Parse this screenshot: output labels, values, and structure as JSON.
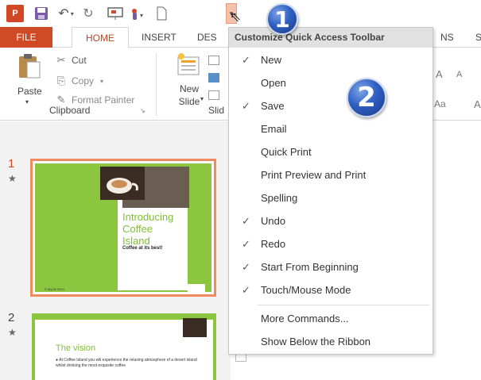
{
  "qat": {
    "logo_text": "P",
    "items": [
      "save-icon",
      "undo-icon",
      "redo-icon",
      "start-from-beginning-icon",
      "touch-mode-icon",
      "new-icon",
      "customize-dropdown-icon"
    ],
    "customize_glyph": "▾"
  },
  "tabs": {
    "file": "FILE",
    "home": "HOME",
    "insert": "INSERT",
    "design": "DES",
    "animations": "NS",
    "slideshow": "S"
  },
  "ribbon": {
    "paste": "Paste",
    "cut": "Cut",
    "copy": "Copy",
    "format_painter": "Format Painter",
    "clipboard_group": "Clipboard",
    "new_slide": "New\nSlide",
    "slides_group": "Slid",
    "font_grow": "A",
    "font_shrink": "A",
    "change_case": "Aa",
    "right_partial": "A"
  },
  "thumbnails": {
    "slide1_num": "1",
    "slide2_num": "2",
    "star": "★",
    "slide1_title": "Introducing\nCoffee\nIsland",
    "slide1_subtitle": "Coffee at its best!",
    "slide1_footer": "© MyOff 2013",
    "slide2_title": "The vision",
    "slide2_text": "● At Coffee Island you will experience the relaxing atmosphere of a desert island whilst drinking the most exquisite coffee"
  },
  "menu": {
    "header": "Customize Quick Access Toolbar",
    "items": [
      {
        "label": "New",
        "checked": "✓"
      },
      {
        "label": "Open",
        "checked": ""
      },
      {
        "label": "Save",
        "checked": "✓"
      },
      {
        "label": "Email",
        "checked": ""
      },
      {
        "label": "Quick Print",
        "checked": ""
      },
      {
        "label": "Print Preview and Print",
        "checked": ""
      },
      {
        "label": "Spelling",
        "checked": ""
      },
      {
        "label": "Undo",
        "checked": "✓"
      },
      {
        "label": "Redo",
        "checked": "✓"
      },
      {
        "label": "Start From Beginning",
        "checked": "✓"
      },
      {
        "label": "Touch/Mouse Mode",
        "checked": "✓"
      },
      {
        "label": "More Commands...",
        "checked": ""
      },
      {
        "label": "Show Below the Ribbon",
        "checked": ""
      }
    ]
  },
  "callouts": {
    "one": "1",
    "two": "2"
  },
  "colors": {
    "accent": "#d04a26",
    "slide_green": "#8cc63f",
    "callout_blue": "#2f5fc2"
  }
}
